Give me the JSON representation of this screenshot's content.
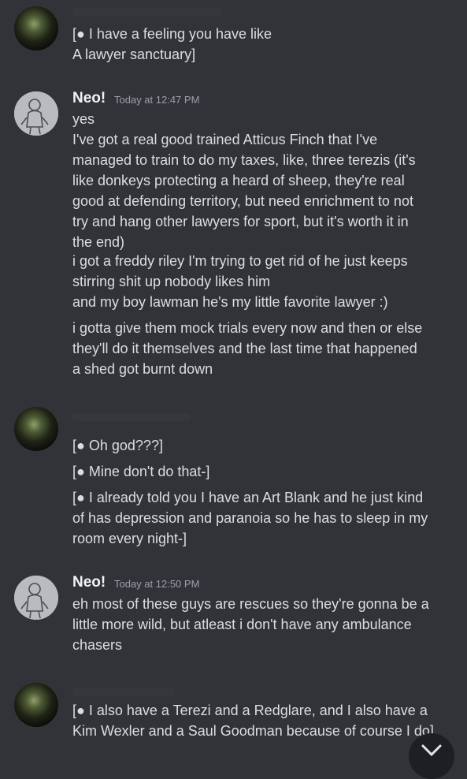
{
  "messages": [
    {
      "id": "m1",
      "author": "",
      "time": "",
      "lines": [
        "[● I have a feeling you have like",
        "A lawyer sanctuary]"
      ]
    },
    {
      "id": "m2",
      "author": "Neo!",
      "time": "Today at 12:47 PM",
      "lines": [
        "yes",
        "I've got a real good trained Atticus Finch that I've",
        "managed to train to do my taxes, like, three terezis (it's",
        "like donkeys protecting a heard of sheep, they're real",
        "good at defending territory, but need enrichment to not",
        "try and hang other lawyers for sport, but it's worth it in",
        "the end)",
        "i got a freddy riley I'm trying to get rid of he just keeps",
        "stirring shit up nobody likes him",
        "and my boy lawman he's my little favorite lawyer :)",
        "i gotta give them mock trials every now and then or else",
        "they'll do it themselves and the last time that happened",
        "a shed got burnt down"
      ]
    },
    {
      "id": "m3",
      "author": "",
      "time": "",
      "lines": [
        "[● Oh god???]",
        "[● Mine don't do that-]",
        "[● I already told you I have an Art Blank and he just kind",
        "of has depression and paranoia so he has to sleep in my",
        "room every night-]"
      ]
    },
    {
      "id": "m4",
      "author": "Neo!",
      "time": "Today at 12:50 PM",
      "lines": [
        "eh most of these guys are rescues so they're gonna be a",
        "little more wild, but atleast i don't have any ambulance",
        "chasers"
      ]
    },
    {
      "id": "m5",
      "author": "",
      "time": "",
      "lines": [
        "[● I also have a Terezi and a Redglare, and I also have a",
        "Kim Wexler and a Saul Goodman because of course I do]"
      ]
    }
  ],
  "icons": {
    "close": "close-icon",
    "avatar_user": "avatar",
    "avatar_neo": "avatar"
  },
  "colors": {
    "background": "#313338",
    "text": "#dbdee1",
    "name": "#f2f3f5",
    "timestamp": "#9aa0a8"
  }
}
